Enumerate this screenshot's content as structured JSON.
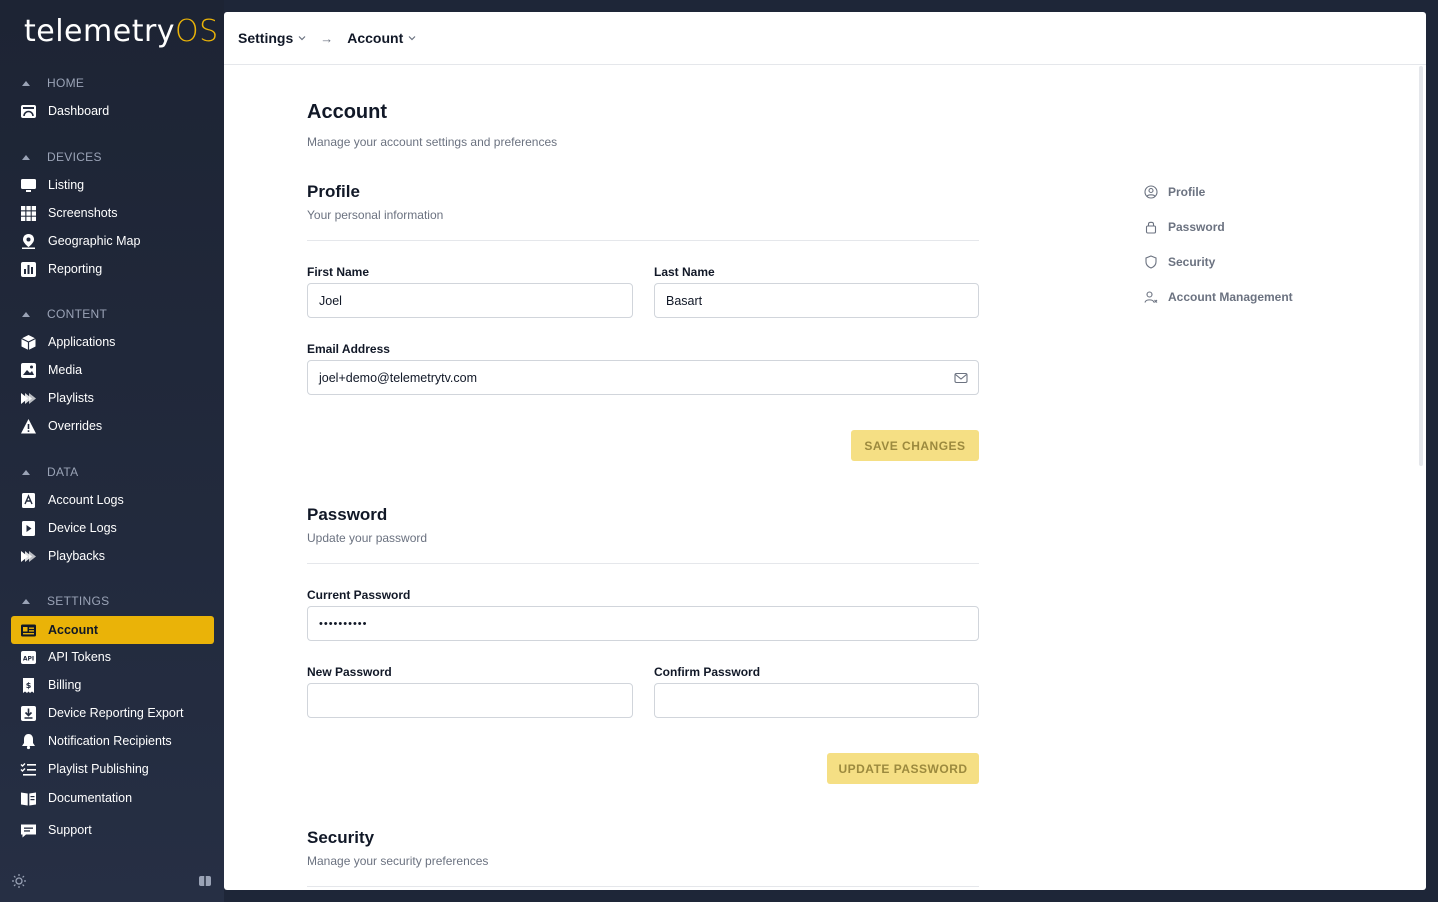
{
  "app": {
    "brand_main": "telemetry",
    "brand_suffix": "OS",
    "accent": "#eab308"
  },
  "sidebar": {
    "sections": [
      {
        "title": "HOME",
        "items": [
          {
            "label": "Dashboard",
            "icon": "dashboard-icon"
          }
        ]
      },
      {
        "title": "DEVICES",
        "items": [
          {
            "label": "Listing",
            "icon": "monitor-icon"
          },
          {
            "label": "Screenshots",
            "icon": "grid-icon"
          },
          {
            "label": "Geographic Map",
            "icon": "map-pin-icon"
          },
          {
            "label": "Reporting",
            "icon": "bar-chart-icon"
          }
        ]
      },
      {
        "title": "CONTENT",
        "items": [
          {
            "label": "Applications",
            "icon": "cube-icon"
          },
          {
            "label": "Media",
            "icon": "image-icon"
          },
          {
            "label": "Playlists",
            "icon": "playlist-icon"
          },
          {
            "label": "Overrides",
            "icon": "warning-icon"
          }
        ]
      },
      {
        "title": "DATA",
        "items": [
          {
            "label": "Account Logs",
            "icon": "account-log-icon"
          },
          {
            "label": "Device Logs",
            "icon": "device-log-icon"
          },
          {
            "label": "Playbacks",
            "icon": "playback-icon"
          }
        ]
      },
      {
        "title": "SETTINGS",
        "items": [
          {
            "label": "Account",
            "icon": "id-card-icon",
            "active": true
          },
          {
            "label": "API Tokens",
            "icon": "api-icon"
          },
          {
            "label": "Billing",
            "icon": "receipt-icon"
          },
          {
            "label": "Device Reporting Export",
            "icon": "download-icon"
          },
          {
            "label": "Notification Recipients",
            "icon": "bell-icon"
          },
          {
            "label": "Playlist Publishing",
            "icon": "list-check-icon"
          }
        ]
      }
    ],
    "footer_items": [
      {
        "label": "Documentation",
        "icon": "book-icon"
      },
      {
        "label": "Support",
        "icon": "chat-icon"
      }
    ]
  },
  "breadcrumb": {
    "items": [
      "Settings",
      "Account"
    ],
    "separator": "→"
  },
  "page": {
    "title": "Account",
    "subtitle": "Manage your account settings and preferences"
  },
  "profile": {
    "title": "Profile",
    "subtitle": "Your personal information",
    "first_name_label": "First Name",
    "first_name_value": "Joel",
    "last_name_label": "Last Name",
    "last_name_value": "Basart",
    "email_label": "Email Address",
    "email_value": "joel+demo@telemetrytv.com",
    "save_label": "SAVE CHANGES"
  },
  "password": {
    "title": "Password",
    "subtitle": "Update your password",
    "current_label": "Current Password",
    "current_value": "••••••••••",
    "new_label": "New Password",
    "new_value": "",
    "confirm_label": "Confirm Password",
    "confirm_value": "",
    "update_label": "UPDATE PASSWORD"
  },
  "security": {
    "title": "Security",
    "subtitle": "Manage your security preferences"
  },
  "toc": [
    {
      "label": "Profile",
      "icon": "user-circle-icon"
    },
    {
      "label": "Password",
      "icon": "lock-icon"
    },
    {
      "label": "Security",
      "icon": "shield-icon"
    },
    {
      "label": "Account Management",
      "icon": "user-x-icon"
    }
  ]
}
